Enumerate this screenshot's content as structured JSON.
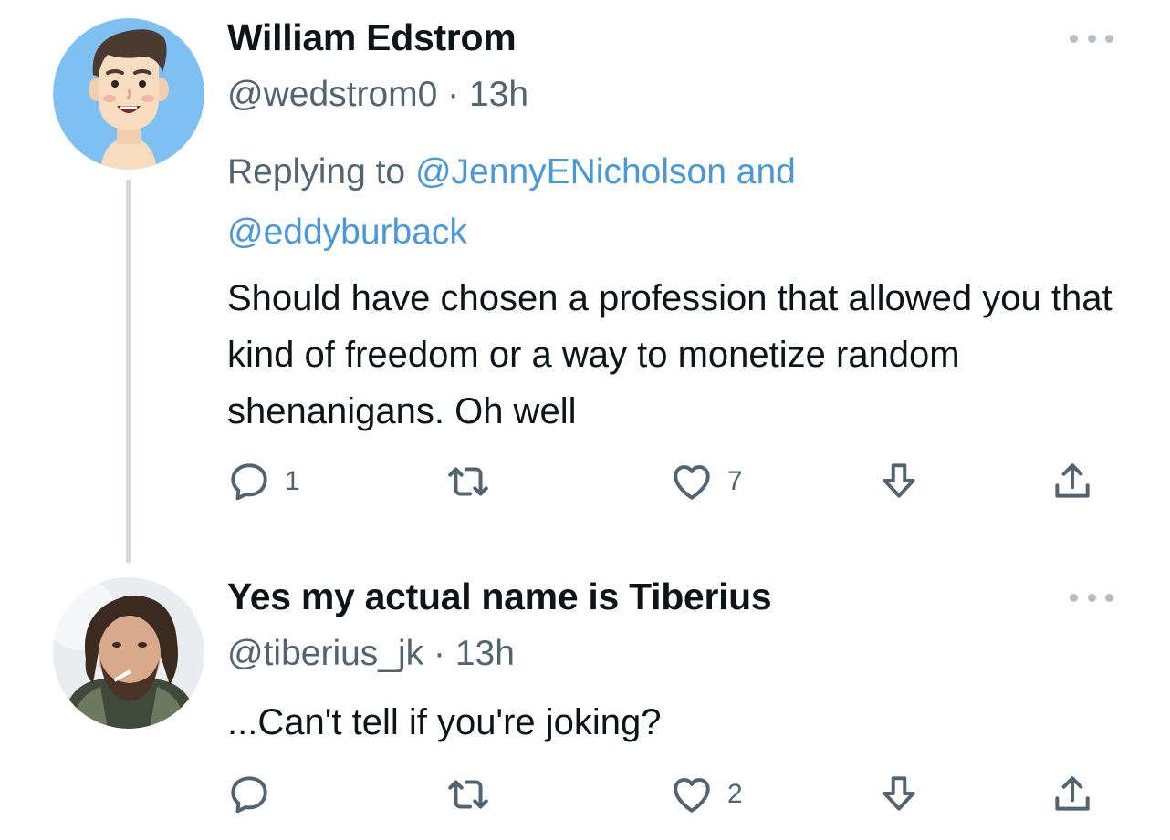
{
  "tweets": [
    {
      "display_name": "William Edstrom",
      "handle": "@wedstrom0",
      "separator": "·",
      "time": "13h",
      "replying_prefix": "Replying to",
      "replying_user1": "@JennyENicholson",
      "replying_and": "and",
      "replying_user2": "@eddyburback",
      "text": "Should have chosen a profession that allowed you that kind of freedom or a way to monetize random shenanigans. Oh well",
      "reply_count": "1",
      "retweet_count": "",
      "like_count": "7",
      "avatar_icon": "cartoon-avatar-icon"
    },
    {
      "display_name": "Yes my actual name is Tiberius",
      "handle": "@tiberius_jk",
      "separator": "·",
      "time": "13h",
      "text": "...Can't tell if you're joking?",
      "reply_count": "",
      "retweet_count": "",
      "like_count": "2",
      "avatar_icon": "photo-avatar"
    }
  ],
  "colors": {
    "link": "#4b98d9",
    "secondary_text": "#536471",
    "icon": "#536471",
    "thread_line": "#cfd9de"
  },
  "icons": {
    "reply": "reply-icon",
    "retweet": "retweet-icon",
    "like": "heart-icon",
    "bookmark": "download-arrow-icon",
    "share": "share-icon",
    "more": "more-dots-icon"
  }
}
